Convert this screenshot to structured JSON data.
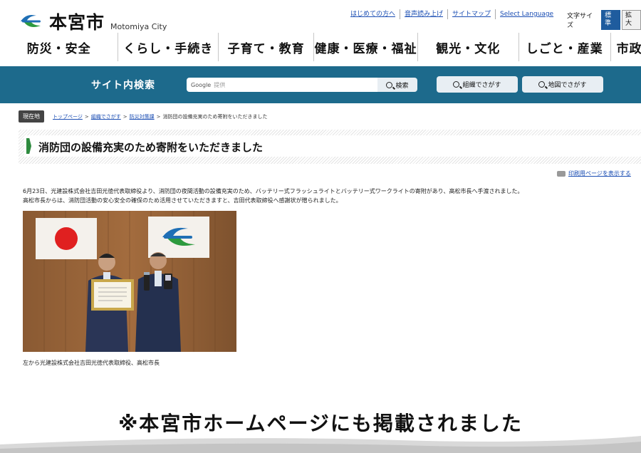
{
  "header": {
    "site_name": "本宮市",
    "site_name_en": "Motomiya City",
    "util_links": [
      "はじめての方へ",
      "音声読み上げ",
      "サイトマップ",
      "Select Language"
    ],
    "font_size_label": "文字サイズ",
    "font_size_standard": "標準",
    "font_size_large": "拡大"
  },
  "nav": {
    "items": [
      "防災・安全",
      "くらし・手続き",
      "子育て・教育",
      "健康・医療・福祉",
      "観光・文化",
      "しごと・産業",
      "市政"
    ]
  },
  "search": {
    "title": "サイト内検索",
    "input_brand": "Google",
    "input_placeholder": "提供",
    "button_label": "検索",
    "org_button": "組織でさがす",
    "map_button": "地図でさがす"
  },
  "breadcrumb": {
    "tag": "現在地",
    "links": [
      "トップページ",
      "組織でさがす",
      "防災対策課"
    ],
    "separator": ">",
    "current": "消防団の設備充実のため寄附をいただきました"
  },
  "article": {
    "title": "消防団の設備充実のため寄附をいただきました",
    "print_link": "印刷用ページを表示する",
    "paragraph1": "6月23日、光建設株式会社吉田光徳代表取締役より、消防団の夜間活動の設備充実のため、バッテリー式フラッシュライトとバッテリー式ワークライトの寄附があり、高松市長へ手渡されました。",
    "paragraph2": "高松市長からは、消防団活動の安心安全の確保のため活用させていただきますと、吉田代表取締役へ感謝状が贈られました。",
    "caption": "左から光建設株式会社吉田光徳代表取締役、高松市長"
  },
  "bottom_note": "※本宮市ホームページにも掲載されました",
  "colors": {
    "search_bar": "#1d6a8c",
    "title_mark": "#2d8a3e",
    "link": "#1a4db3"
  }
}
